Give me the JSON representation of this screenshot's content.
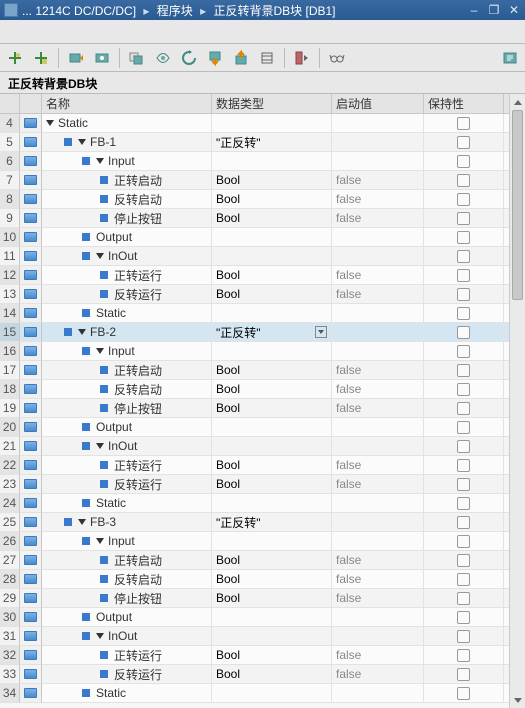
{
  "title": {
    "crumb1": "... 1214C DC/DC/DC]",
    "crumb2": "程序块",
    "crumb3": "正反转背景DB块 [DB1]"
  },
  "block_title": "正反转背景DB块",
  "headers": {
    "name": "名称",
    "type": "数据类型",
    "start": "启动值",
    "retain": "保持性"
  },
  "decl_icon_name": "decl-icon",
  "chk": "checkbox",
  "rows": [
    {
      "rn": 4,
      "decl": true,
      "lvl": 0,
      "caret": true,
      "label": "Static",
      "type": "",
      "start": "",
      "chk": true
    },
    {
      "rn": 5,
      "decl": true,
      "lvl": 1,
      "caret": true,
      "marker": true,
      "label": "FB-1",
      "type": "\"正反转\"",
      "start": "",
      "chk": true
    },
    {
      "rn": 6,
      "decl": true,
      "lvl": 2,
      "caret": true,
      "marker": true,
      "label": "Input",
      "type": "",
      "start": "",
      "chk": true
    },
    {
      "rn": 7,
      "decl": true,
      "lvl": 3,
      "marker": true,
      "label": "正转启动",
      "type": "Bool",
      "start": "false",
      "chk": true
    },
    {
      "rn": 8,
      "decl": true,
      "lvl": 3,
      "marker": true,
      "label": "反转启动",
      "type": "Bool",
      "start": "false",
      "chk": true
    },
    {
      "rn": 9,
      "decl": true,
      "lvl": 3,
      "marker": true,
      "label": "停止按钮",
      "type": "Bool",
      "start": "false",
      "chk": true
    },
    {
      "rn": 10,
      "decl": true,
      "lvl": 2,
      "marker": true,
      "label": "Output",
      "type": "",
      "start": "",
      "chk": true
    },
    {
      "rn": 11,
      "decl": true,
      "lvl": 2,
      "caret": true,
      "marker": true,
      "label": "InOut",
      "type": "",
      "start": "",
      "chk": true
    },
    {
      "rn": 12,
      "decl": true,
      "lvl": 3,
      "marker": true,
      "label": "正转运行",
      "type": "Bool",
      "start": "false",
      "chk": true
    },
    {
      "rn": 13,
      "decl": true,
      "lvl": 3,
      "marker": true,
      "label": "反转运行",
      "type": "Bool",
      "start": "false",
      "chk": true
    },
    {
      "rn": 14,
      "decl": true,
      "lvl": 2,
      "marker": true,
      "label": "Static",
      "type": "",
      "start": "",
      "chk": true
    },
    {
      "rn": 15,
      "decl": true,
      "lvl": 1,
      "caret": true,
      "marker": true,
      "label": "FB-2",
      "type": "\"正反转\"",
      "start": "",
      "chk": true,
      "selected": true,
      "dd": true
    },
    {
      "rn": 16,
      "decl": true,
      "lvl": 2,
      "caret": true,
      "marker": true,
      "label": "Input",
      "type": "",
      "start": "",
      "chk": true
    },
    {
      "rn": 17,
      "decl": true,
      "lvl": 3,
      "marker": true,
      "label": "正转启动",
      "type": "Bool",
      "start": "false",
      "chk": true
    },
    {
      "rn": 18,
      "decl": true,
      "lvl": 3,
      "marker": true,
      "label": "反转启动",
      "type": "Bool",
      "start": "false",
      "chk": true
    },
    {
      "rn": 19,
      "decl": true,
      "lvl": 3,
      "marker": true,
      "label": "停止按钮",
      "type": "Bool",
      "start": "false",
      "chk": true
    },
    {
      "rn": 20,
      "decl": true,
      "lvl": 2,
      "marker": true,
      "label": "Output",
      "type": "",
      "start": "",
      "chk": true
    },
    {
      "rn": 21,
      "decl": true,
      "lvl": 2,
      "caret": true,
      "marker": true,
      "label": "InOut",
      "type": "",
      "start": "",
      "chk": true
    },
    {
      "rn": 22,
      "decl": true,
      "lvl": 3,
      "marker": true,
      "label": "正转运行",
      "type": "Bool",
      "start": "false",
      "chk": true
    },
    {
      "rn": 23,
      "decl": true,
      "lvl": 3,
      "marker": true,
      "label": "反转运行",
      "type": "Bool",
      "start": "false",
      "chk": true
    },
    {
      "rn": 24,
      "decl": true,
      "lvl": 2,
      "marker": true,
      "label": "Static",
      "type": "",
      "start": "",
      "chk": true
    },
    {
      "rn": 25,
      "decl": true,
      "lvl": 1,
      "caret": true,
      "marker": true,
      "label": "FB-3",
      "type": "\"正反转\"",
      "start": "",
      "chk": true
    },
    {
      "rn": 26,
      "decl": true,
      "lvl": 2,
      "caret": true,
      "marker": true,
      "label": "Input",
      "type": "",
      "start": "",
      "chk": true
    },
    {
      "rn": 27,
      "decl": true,
      "lvl": 3,
      "marker": true,
      "label": "正转启动",
      "type": "Bool",
      "start": "false",
      "chk": true
    },
    {
      "rn": 28,
      "decl": true,
      "lvl": 3,
      "marker": true,
      "label": "反转启动",
      "type": "Bool",
      "start": "false",
      "chk": true
    },
    {
      "rn": 29,
      "decl": true,
      "lvl": 3,
      "marker": true,
      "label": "停止按钮",
      "type": "Bool",
      "start": "false",
      "chk": true
    },
    {
      "rn": 30,
      "decl": true,
      "lvl": 2,
      "marker": true,
      "label": "Output",
      "type": "",
      "start": "",
      "chk": true
    },
    {
      "rn": 31,
      "decl": true,
      "lvl": 2,
      "caret": true,
      "marker": true,
      "label": "InOut",
      "type": "",
      "start": "",
      "chk": true
    },
    {
      "rn": 32,
      "decl": true,
      "lvl": 3,
      "marker": true,
      "label": "正转运行",
      "type": "Bool",
      "start": "false",
      "chk": true
    },
    {
      "rn": 33,
      "decl": true,
      "lvl": 3,
      "marker": true,
      "label": "反转运行",
      "type": "Bool",
      "start": "false",
      "chk": true
    },
    {
      "rn": 34,
      "decl": true,
      "lvl": 2,
      "marker": true,
      "label": "Static",
      "type": "",
      "start": "",
      "chk": true
    }
  ]
}
